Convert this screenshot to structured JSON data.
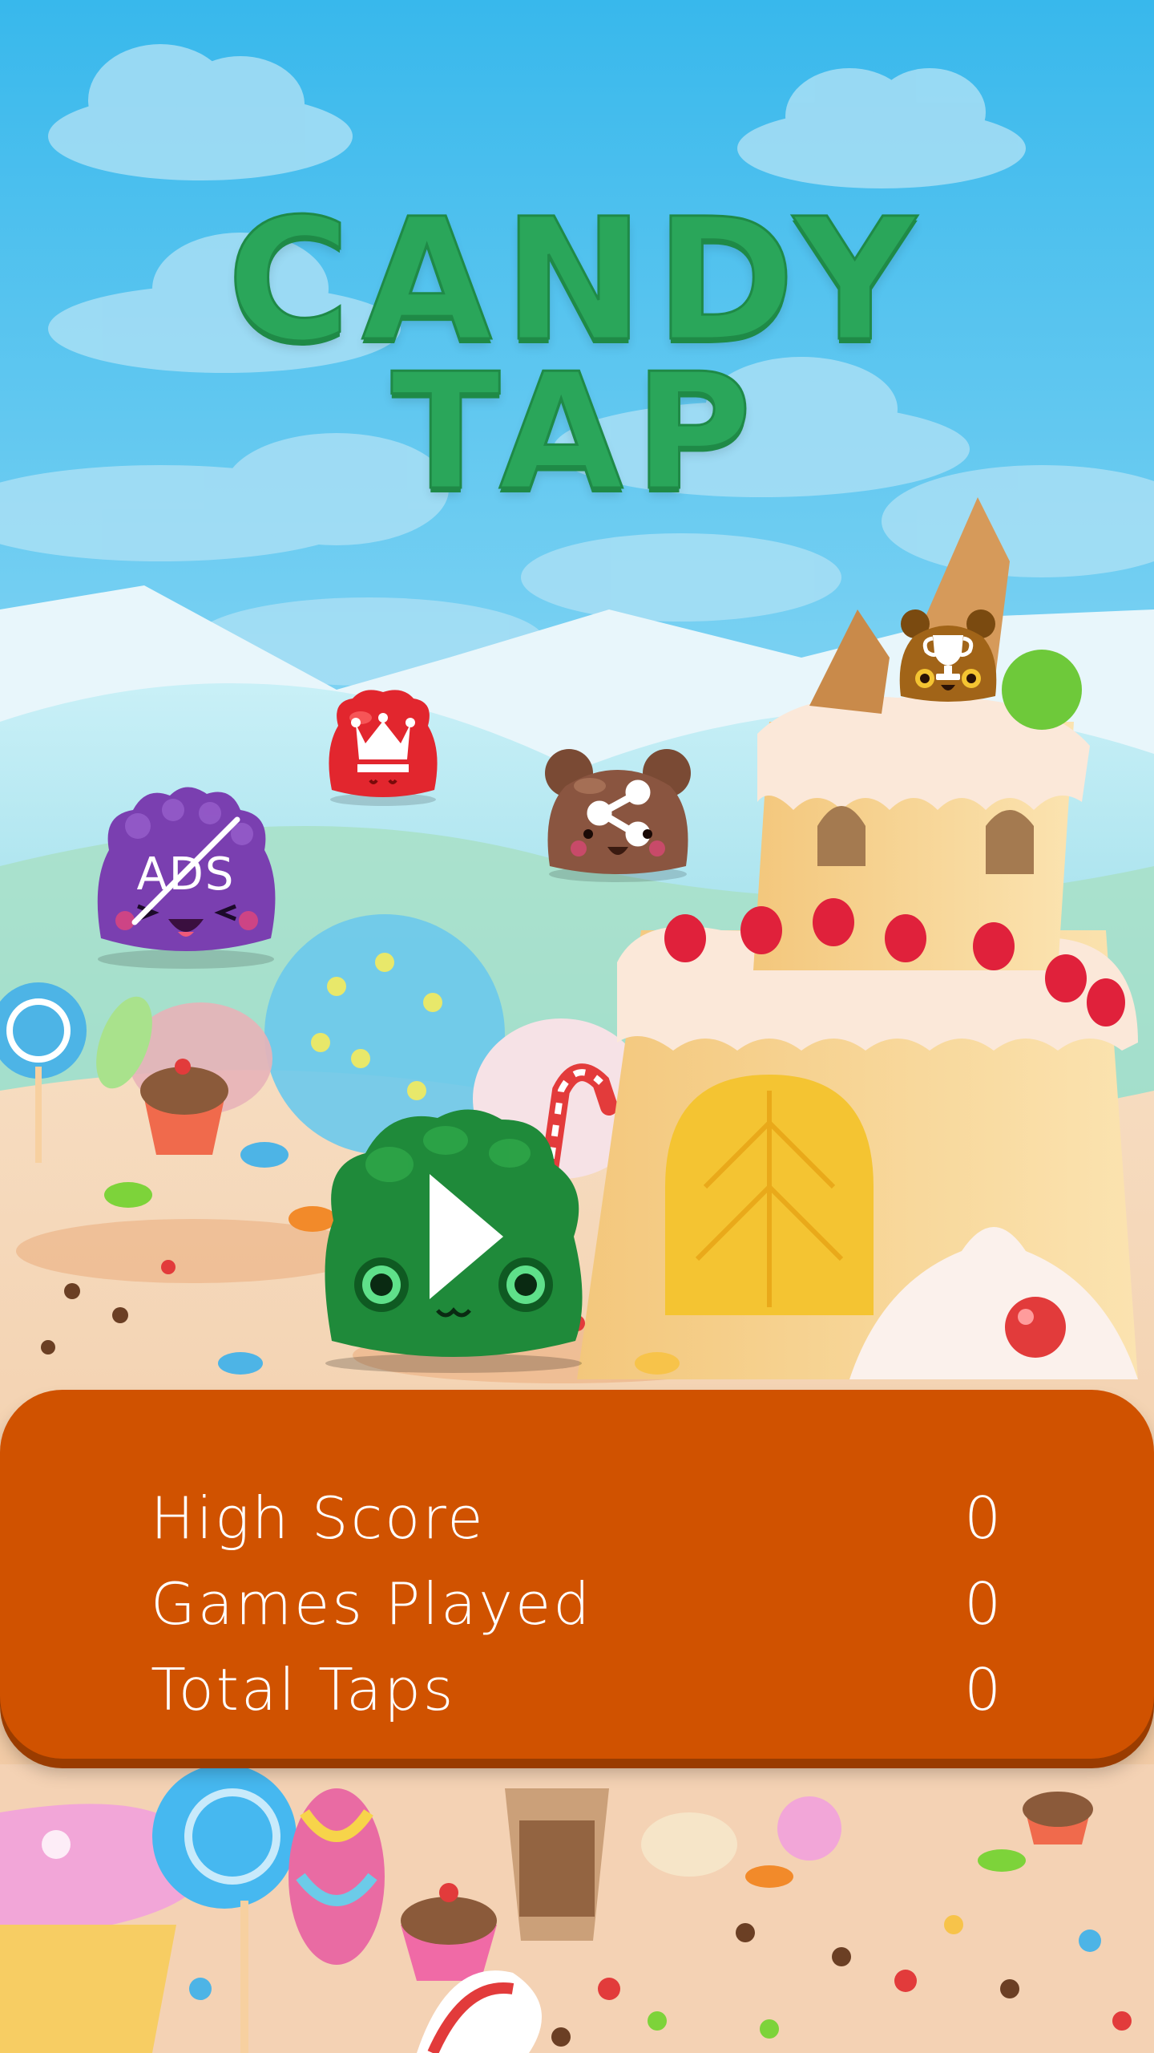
{
  "title": {
    "line1": "CANDY",
    "line2": "TAP"
  },
  "buttons": {
    "play": {
      "icon": "play-icon"
    },
    "leaderboard": {
      "icon": "crown-icon"
    },
    "share": {
      "icon": "share-icon"
    },
    "remove_ads": {
      "icon": "no-ads-icon",
      "label": "ADS"
    },
    "achievements": {
      "icon": "trophy-icon"
    }
  },
  "stats": [
    {
      "label": "High Score",
      "value": "0"
    },
    {
      "label": "Games Played",
      "value": "0"
    },
    {
      "label": "Total Taps",
      "value": "0"
    }
  ],
  "colors": {
    "title": "#2aa65a",
    "panel": "#d05200",
    "sky": "#43bdea"
  }
}
